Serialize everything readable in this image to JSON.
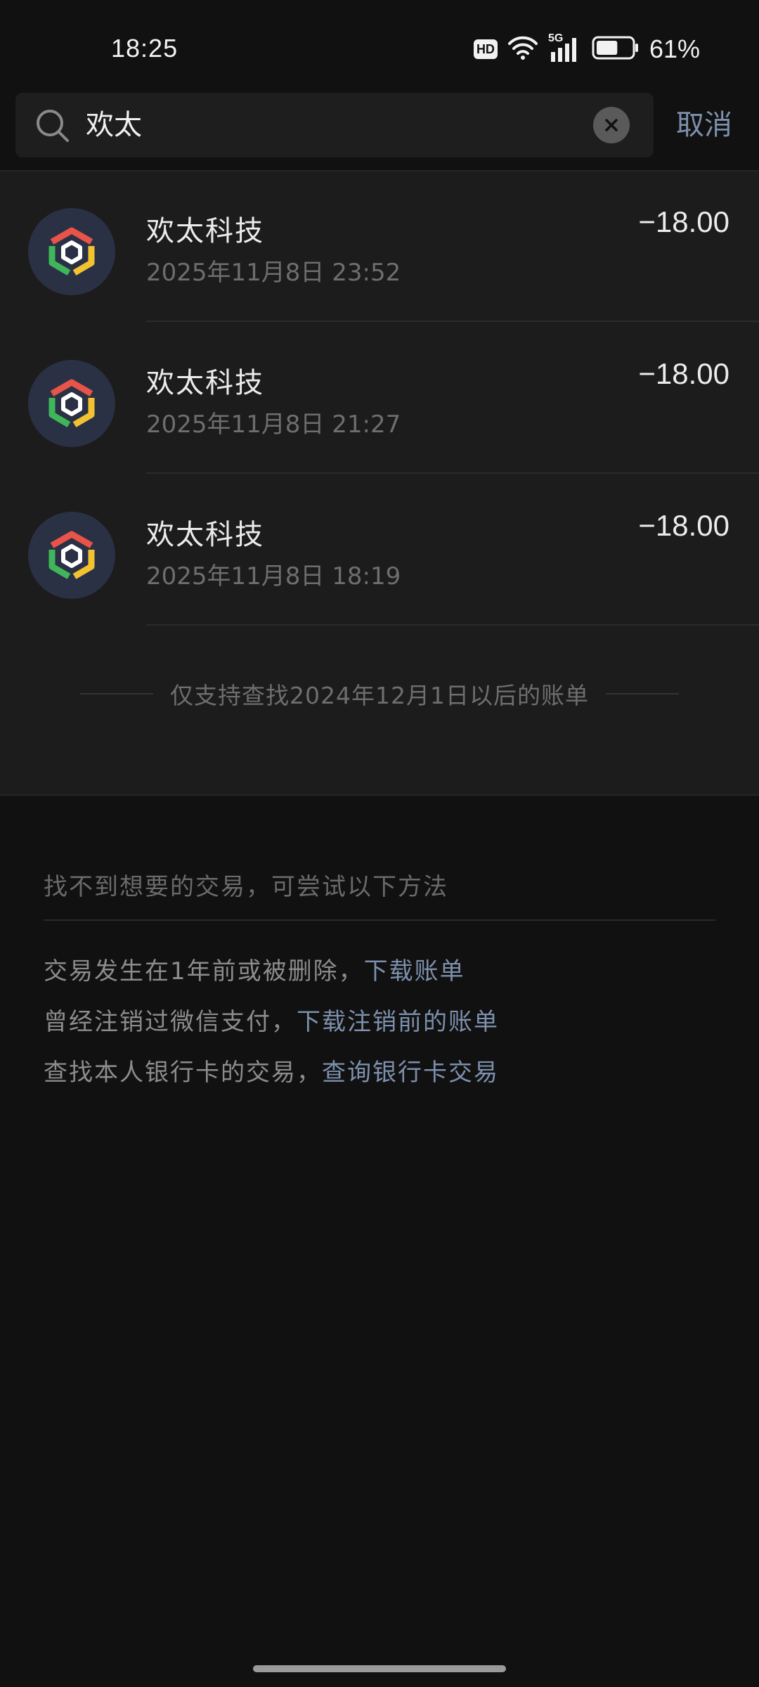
{
  "status_bar": {
    "time": "18:25",
    "hd_label": "HD",
    "network_label": "5G",
    "battery_percent": "61%",
    "battery_level": 0.61
  },
  "search": {
    "query": "欢太",
    "cancel_label": "取消"
  },
  "results": [
    {
      "merchant": "欢太科技",
      "datetime": "2025年11月8日 23:52",
      "amount": "−18.00"
    },
    {
      "merchant": "欢太科技",
      "datetime": "2025年11月8日 21:27",
      "amount": "−18.00"
    },
    {
      "merchant": "欢太科技",
      "datetime": "2025年11月8日 18:19",
      "amount": "−18.00"
    }
  ],
  "range_note": "仅支持查找2024年12月1日以后的账单",
  "help": {
    "title": "找不到想要的交易，可尝试以下方法",
    "items": [
      {
        "text": "交易发生在1年前或被删除，",
        "link": "下载账单"
      },
      {
        "text": "曾经注销过微信支付，",
        "link": "下载注销前的账单"
      },
      {
        "text": "查找本人银行卡的交易，",
        "link": "查询银行卡交易"
      }
    ]
  },
  "icons": {
    "search": "search-icon",
    "clear": "clear-icon",
    "merchant_logo": "merchant-logo-icon",
    "wifi": "wifi-icon",
    "signal": "signal-icon",
    "battery": "battery-icon"
  },
  "colors": {
    "background": "#111111",
    "panel": "#1c1c1c",
    "link": "#7d90ad",
    "logo_red": "#e8534a",
    "logo_green": "#3fb65a",
    "logo_yellow": "#f2c230",
    "avatar_bg": "#2a3144"
  }
}
